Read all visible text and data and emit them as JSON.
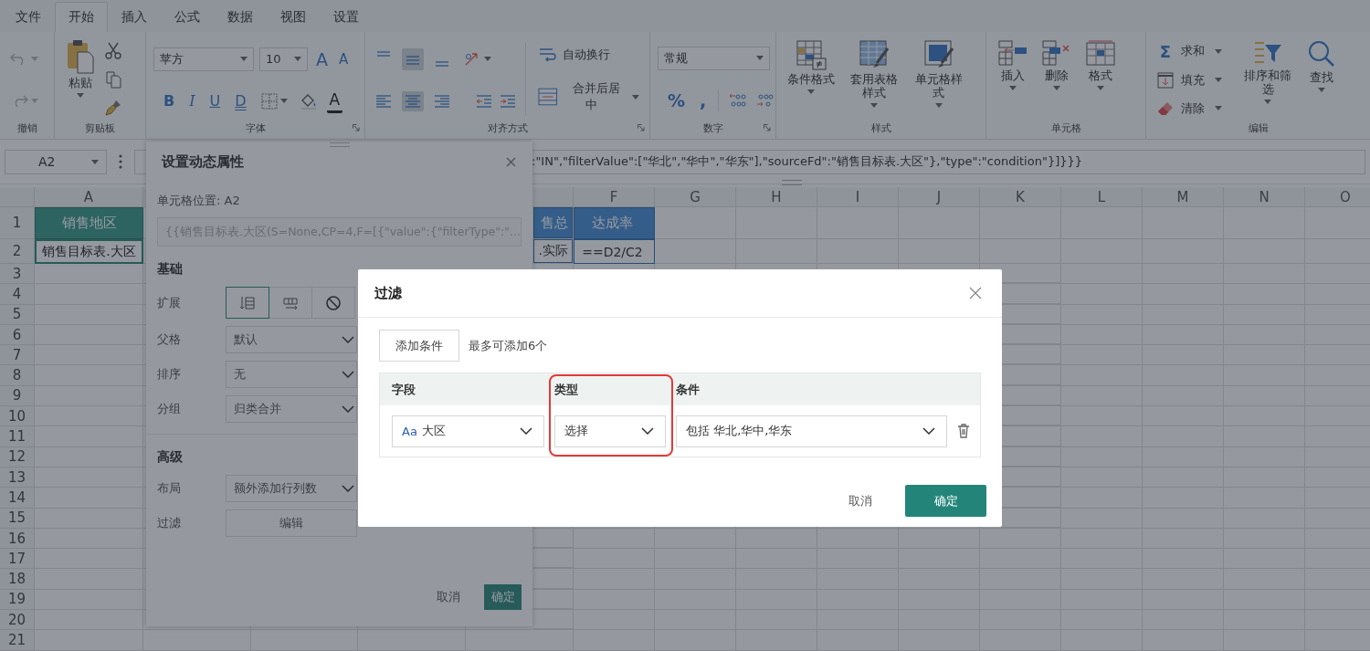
{
  "menu_tabs": [
    {
      "label": "文件",
      "selected": false
    },
    {
      "label": "开始",
      "selected": true
    },
    {
      "label": "插入",
      "selected": false
    },
    {
      "label": "公式",
      "selected": false
    },
    {
      "label": "数据",
      "selected": false
    },
    {
      "label": "视图",
      "selected": false
    },
    {
      "label": "设置",
      "selected": false
    }
  ],
  "ribbon": {
    "undo": {
      "label": "撤销",
      "disabled": true
    },
    "clipboard": {
      "label": "剪贴板",
      "paste": "粘贴"
    },
    "font": {
      "label": "字体",
      "family": "苹方",
      "size": "10",
      "grow": "A",
      "shrink": "A",
      "styles": [
        "B",
        "I",
        "U",
        "D"
      ],
      "color_letter": "A"
    },
    "alignment": {
      "label": "对齐方式",
      "vertical": [
        {
          "selected": false
        },
        {
          "selected": true
        },
        {
          "selected": false
        }
      ],
      "horizontal": [
        {
          "selected": false
        },
        {
          "selected": true
        },
        {
          "selected": false
        }
      ],
      "wrap": "自动换行",
      "merge": "合并后居中"
    },
    "number": {
      "label": "数字",
      "format": "常规",
      "percent": "%",
      "comma": ","
    },
    "styles": {
      "label": "样式",
      "buttons": [
        "条件格式",
        "套用表格样式",
        "单元格样式"
      ]
    },
    "cells": {
      "label": "单元格",
      "buttons": [
        "插入",
        "删除",
        "格式"
      ]
    },
    "editing": {
      "label": "编辑",
      "sum_symbol": "Σ",
      "sum": "求和",
      "fill": "填充",
      "clear": "清除",
      "sort": "排序和筛选",
      "find": "查找"
    }
  },
  "formula_bar": {
    "name_box": "A2",
    "formula": ":\"IN\",\"filterValue\":[\"华北\",\"华中\",\"华东\"],\"sourceFd\":\"销售目标表.大区\"},\"type\":\"condition\"}]}}}"
  },
  "sheet": {
    "column_headers": {
      "before_panel": [
        "A"
      ],
      "after_panel": [
        "F",
        "G",
        "H",
        "I",
        "J",
        "K",
        "L",
        "M",
        "N",
        "O"
      ]
    },
    "rows": [
      {
        "number": "1",
        "cells": {
          "A": {
            "text": "销售地区",
            "kind": "teal"
          },
          "E": {
            "text": "售总",
            "kind": "blue"
          },
          "F": {
            "text": "达成率",
            "kind": "blue"
          }
        }
      },
      {
        "number": "2",
        "cells": {
          "A": {
            "text": "销售目标表.大区",
            "kind": "active"
          },
          "E": {
            "text": ".实际",
            "kind": "outlined"
          },
          "F": {
            "text": "==D2/C2",
            "kind": "outlined"
          }
        }
      },
      {
        "number": "3"
      },
      {
        "number": "4"
      },
      {
        "number": "5"
      },
      {
        "number": "6"
      },
      {
        "number": "7"
      },
      {
        "number": "8"
      },
      {
        "number": "9"
      },
      {
        "number": "10"
      },
      {
        "number": "11"
      },
      {
        "number": "12"
      },
      {
        "number": "13"
      },
      {
        "number": "14"
      },
      {
        "number": "15"
      },
      {
        "number": "16"
      },
      {
        "number": "17"
      },
      {
        "number": "18"
      },
      {
        "number": "19"
      },
      {
        "number": "20"
      },
      {
        "number": "21"
      }
    ]
  },
  "panel": {
    "title": "设置动态属性",
    "cell_position": "单元格位置: A2",
    "expression": "{{销售目标表.大区(S=None,CP=4,F=[{\"value\":{\"filterType\":\"...",
    "sections": [
      {
        "title": "基础",
        "rows": [
          {
            "label": "扩展",
            "kind": "toggles",
            "options": [
              {
                "selected": true
              },
              {
                "selected": false
              },
              {
                "selected": false
              }
            ]
          },
          {
            "label": "父格",
            "kind": "select",
            "value": "默认"
          },
          {
            "label": "排序",
            "kind": "select",
            "value": "无"
          },
          {
            "label": "分组",
            "kind": "select",
            "value": "归类合并"
          }
        ]
      },
      {
        "title": "高级",
        "rows": [
          {
            "label": "布局",
            "kind": "select",
            "value": "额外添加行列数"
          },
          {
            "label": "过滤",
            "kind": "button",
            "value": "编辑"
          }
        ]
      }
    ],
    "buttons": [
      {
        "label": "取消",
        "kind": "secondary"
      },
      {
        "label": "确定",
        "kind": "primary"
      }
    ]
  },
  "filter_dialog": {
    "title": "过滤",
    "add_button": "添加条件",
    "hint": "最多可添加6个",
    "columns": [
      {
        "label": "字段",
        "highlighted": false
      },
      {
        "label": "类型",
        "highlighted": true
      },
      {
        "label": "条件",
        "highlighted": false
      }
    ],
    "conditions": [
      {
        "field_icon": "Aa",
        "field": "大区",
        "type": "选择",
        "condition": "包括 华北,华中,华东"
      }
    ],
    "buttons": [
      {
        "label": "取消",
        "kind": "secondary"
      },
      {
        "label": "确定",
        "kind": "primary"
      }
    ]
  }
}
